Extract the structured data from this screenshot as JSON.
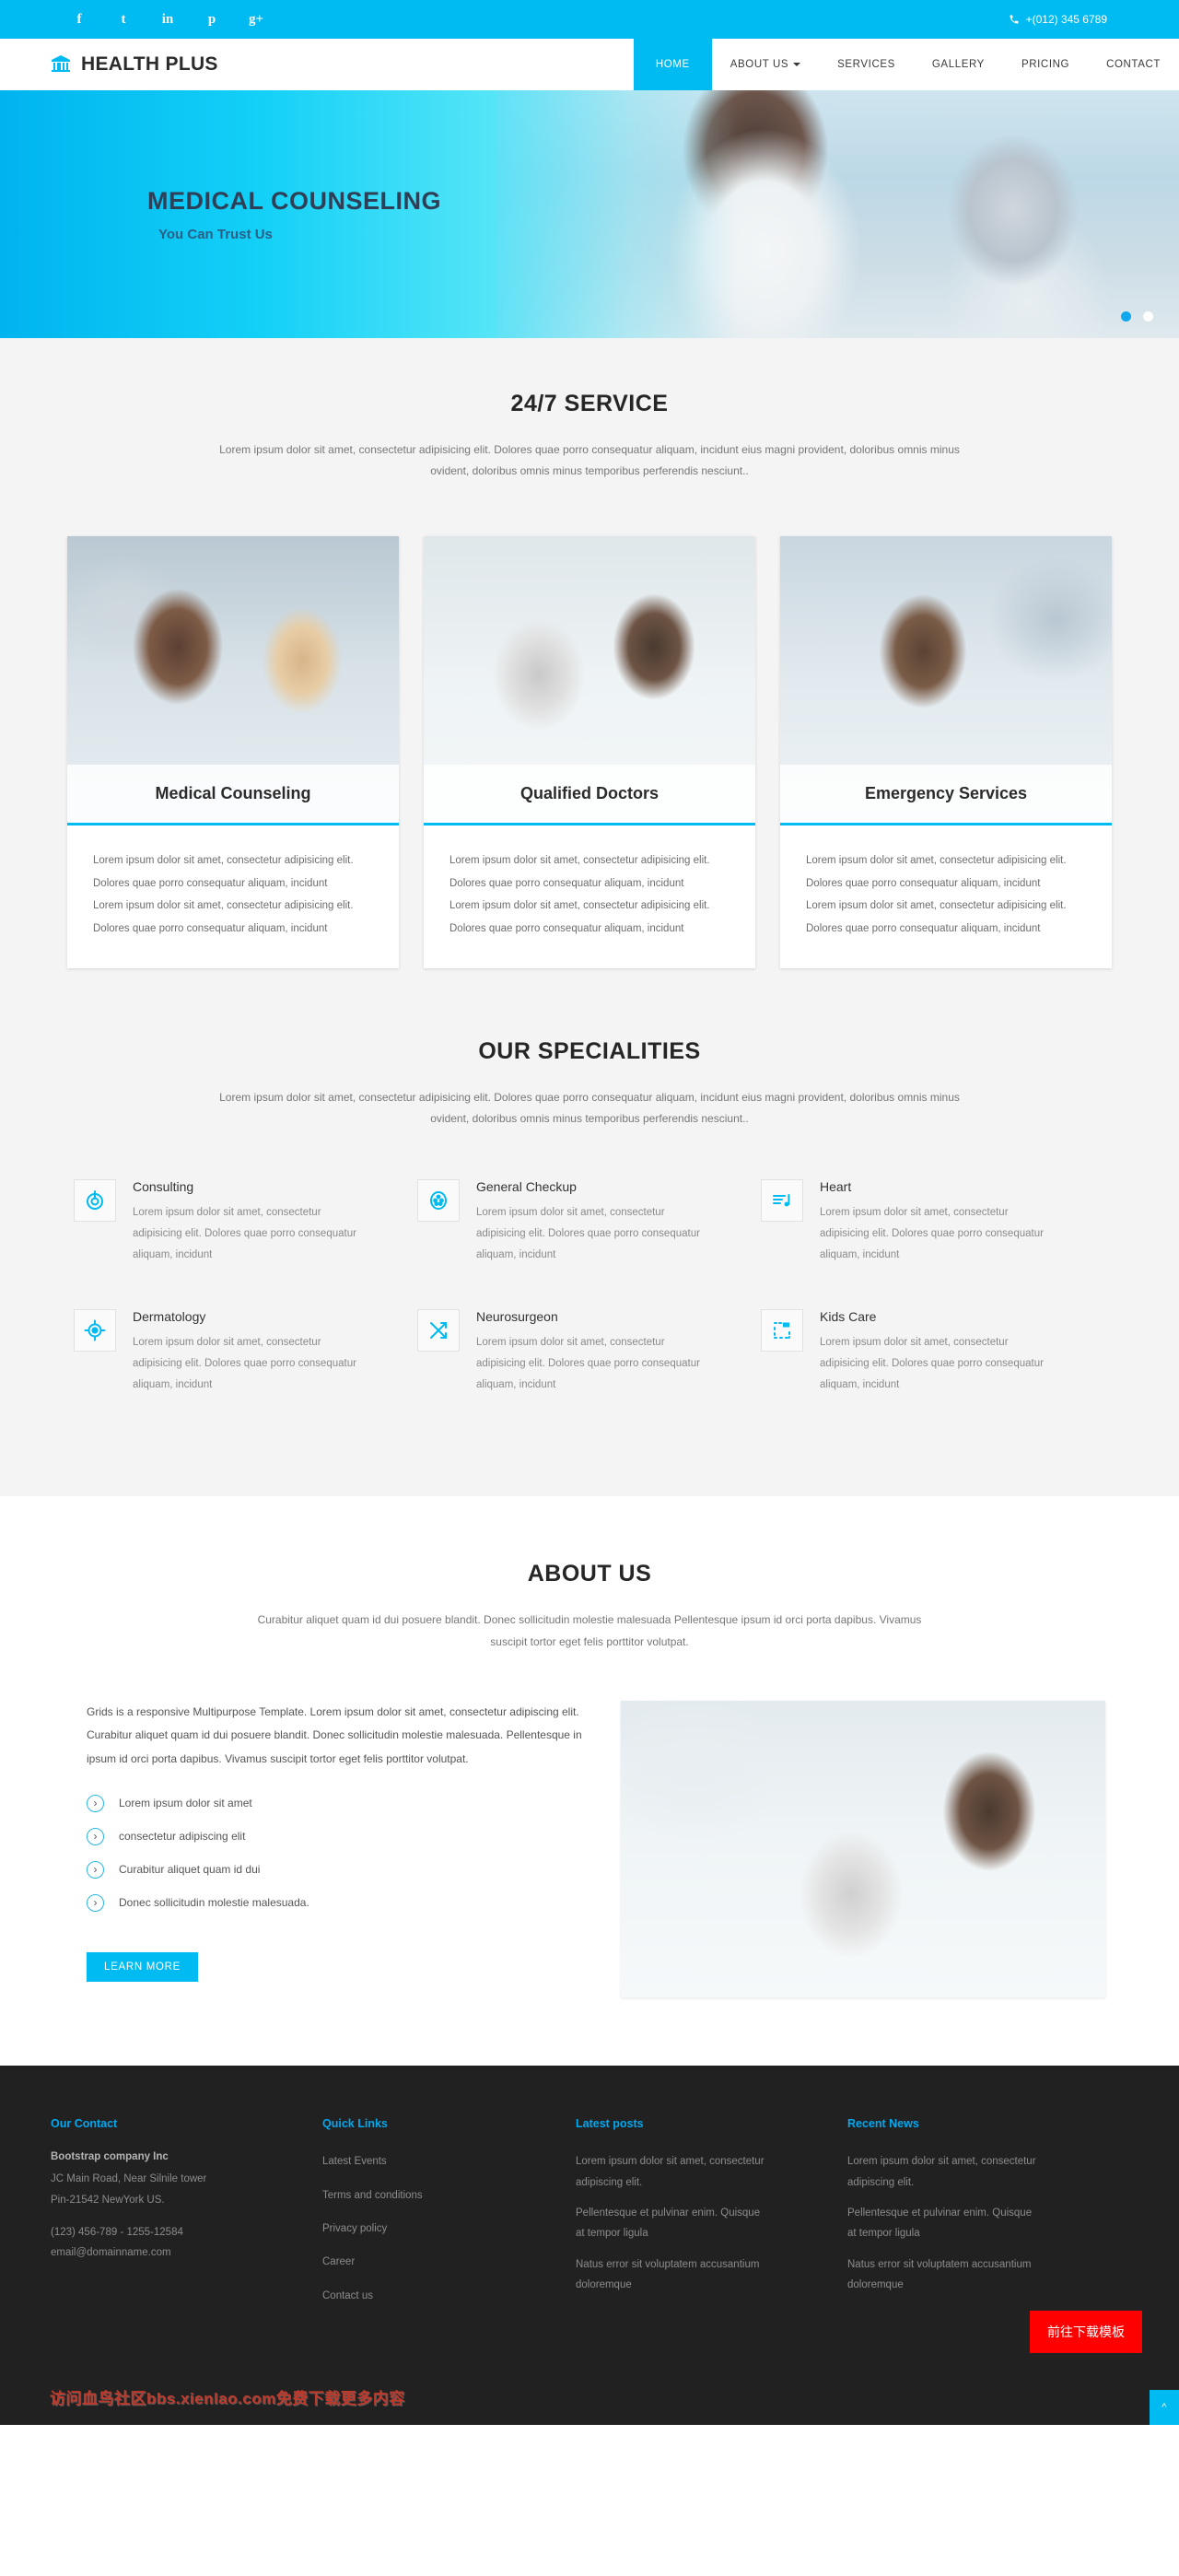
{
  "topbar": {
    "social": [
      {
        "name": "facebook-icon",
        "glyph": "f"
      },
      {
        "name": "twitter-icon",
        "glyph": "t"
      },
      {
        "name": "linkedin-icon",
        "glyph": "in"
      },
      {
        "name": "pinterest-icon",
        "glyph": "p"
      },
      {
        "name": "googleplus-icon",
        "glyph": "g+"
      }
    ],
    "phone": "+(012) 345 6789"
  },
  "header": {
    "brand": "HEALTH PLUS",
    "nav": [
      {
        "label": "HOME",
        "active": true,
        "caret": false
      },
      {
        "label": "ABOUT US",
        "active": false,
        "caret": true
      },
      {
        "label": "SERVICES",
        "active": false,
        "caret": false
      },
      {
        "label": "GALLERY",
        "active": false,
        "caret": false
      },
      {
        "label": "PRICING",
        "active": false,
        "caret": false
      },
      {
        "label": "CONTACT",
        "active": false,
        "caret": false
      }
    ]
  },
  "hero": {
    "title": "MEDICAL COUNSELING",
    "subtitle": "You Can Trust Us",
    "slides": 2,
    "active_slide": 1
  },
  "service_section": {
    "title": "24/7 SERVICE",
    "desc": "Lorem ipsum dolor sit amet, consectetur adipisicing elit. Dolores quae porro consequatur aliquam, incidunt eius magni provident, doloribus omnis minus ovident, doloribus omnis minus temporibus perferendis nesciunt..",
    "cards": [
      {
        "title": "Medical Counseling",
        "lines": [
          "Lorem ipsum dolor sit amet, consectetur adipisicing elit.",
          "Dolores quae porro consequatur aliquam, incidunt",
          "Lorem ipsum dolor sit amet, consectetur adipisicing elit.",
          "Dolores quae porro consequatur aliquam, incidunt"
        ]
      },
      {
        "title": "Qualified Doctors",
        "lines": [
          "Lorem ipsum dolor sit amet, consectetur adipisicing elit.",
          "Dolores quae porro consequatur aliquam, incidunt",
          "Lorem ipsum dolor sit amet, consectetur adipisicing elit.",
          "Dolores quae porro consequatur aliquam, incidunt"
        ]
      },
      {
        "title": "Emergency Services",
        "lines": [
          "Lorem ipsum dolor sit amet, consectetur adipisicing elit.",
          "Dolores quae porro consequatur aliquam, incidunt",
          "Lorem ipsum dolor sit amet, consectetur adipisicing elit.",
          "Dolores quae porro consequatur aliquam, incidunt"
        ]
      }
    ]
  },
  "specialities": {
    "title": "OUR SPECIALITIES",
    "desc": "Lorem ipsum dolor sit amet, consectetur adipisicing elit. Dolores quae porro consequatur aliquam, incidunt eius magni provident, doloribus omnis minus ovident, doloribus omnis minus temporibus perferendis nesciunt..",
    "items": [
      {
        "icon": "power-target-icon",
        "title": "Consulting",
        "text": "Lorem ipsum dolor sit amet, consectetur adipisicing elit. Dolores quae porro consequatur aliquam, incidunt"
      },
      {
        "icon": "dots-circle-icon",
        "title": "General Checkup",
        "text": "Lorem ipsum dolor sit amet, consectetur adipisicing elit. Dolores quae porro consequatur aliquam, incidunt"
      },
      {
        "icon": "music-note-list-icon",
        "title": "Heart",
        "text": "Lorem ipsum dolor sit amet, consectetur adipisicing elit. Dolores quae porro consequatur aliquam, incidunt"
      },
      {
        "icon": "crosshair-icon",
        "title": "Dermatology",
        "text": "Lorem ipsum dolor sit amet, consectetur adipisicing elit. Dolores quae porro consequatur aliquam, incidunt"
      },
      {
        "icon": "shuffle-arrows-icon",
        "title": "Neurosurgeon",
        "text": "Lorem ipsum dolor sit amet, consectetur adipisicing elit. Dolores quae porro consequatur aliquam, incidunt"
      },
      {
        "icon": "dashed-crop-icon",
        "title": "Kids Care",
        "text": "Lorem ipsum dolor sit amet, consectetur adipisicing elit. Dolores quae porro consequatur aliquam, incidunt"
      }
    ]
  },
  "about": {
    "title": "ABOUT US",
    "desc": "Curabitur aliquet quam id dui posuere blandit. Donec sollicitudin molestie malesuada Pellentesque ipsum id orci porta dapibus. Vivamus suscipit tortor eget felis porttitor volutpat.",
    "body": "Grids is a responsive Multipurpose Template. Lorem ipsum dolor sit amet, consectetur adipiscing elit. Curabitur aliquet quam id dui posuere blandit. Donec sollicitudin molestie malesuada. Pellentesque in ipsum id orci porta dapibus. Vivamus suscipit tortor eget felis porttitor volutpat.",
    "bullets": [
      "Lorem ipsum dolor sit amet",
      "consectetur adipiscing elit",
      "Curabitur aliquet quam id dui",
      "Donec sollicitudin molestie malesuada."
    ],
    "cta": "LEARN MORE"
  },
  "footer": {
    "contact": {
      "heading": "Our Contact",
      "company": "Bootstrap company Inc",
      "address1": "JC Main Road, Near Silnile tower",
      "address2": "Pin-21542 NewYork US.",
      "phone": "(123) 456-789 - 1255-12584",
      "email": "email@domainname.com"
    },
    "quick_links": {
      "heading": "Quick Links",
      "items": [
        "Latest Events",
        "Terms and conditions",
        "Privacy policy",
        "Career",
        "Contact us"
      ]
    },
    "latest_posts": {
      "heading": "Latest posts",
      "items": [
        "Lorem ipsum dolor sit amet, consectetur adipiscing elit.",
        "Pellentesque et pulvinar enim. Quisque at tempor ligula",
        "Natus error sit voluptatem accusantium doloremque"
      ]
    },
    "recent_news": {
      "heading": "Recent News",
      "items": [
        "Lorem ipsum dolor sit amet, consectetur adipiscing elit.",
        "Pellentesque et pulvinar enim. Quisque at tempor ligula",
        "Natus error sit voluptatem accusantium doloremque"
      ]
    },
    "watermark": "访问血鸟社区bbs.xienlao.com免费下载更多内容",
    "download_badge": "前往下载模板",
    "back_to_top": "^"
  },
  "colors": {
    "accent": "#00bbf2",
    "dark": "#212121",
    "badge_red": "#ff0000"
  }
}
